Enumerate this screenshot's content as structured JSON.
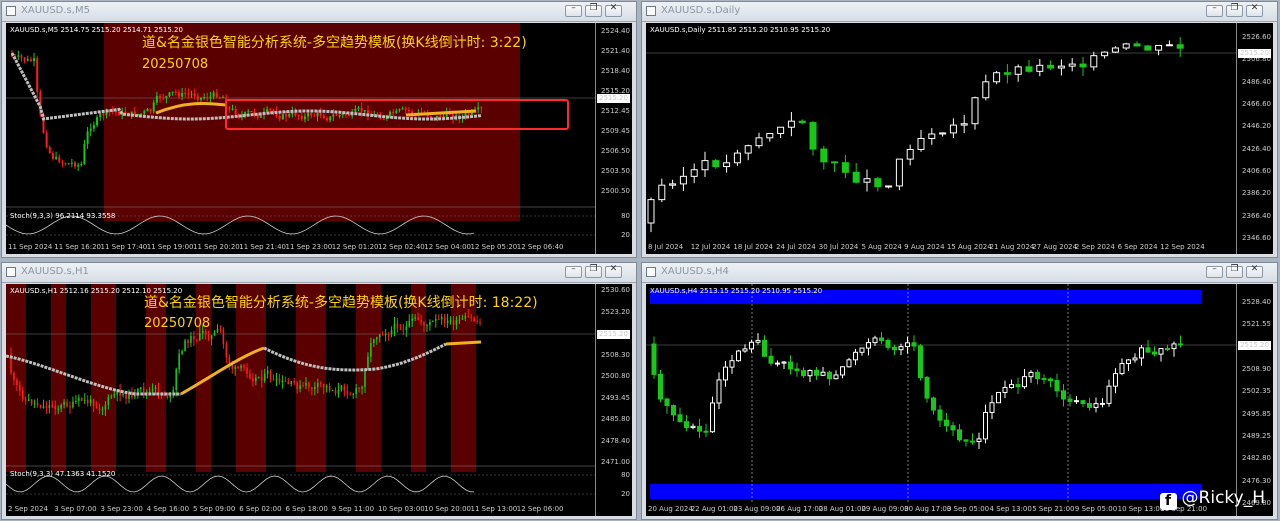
{
  "windows": [
    {
      "id": "m5",
      "title": "XAUUSD.s,M5",
      "header": "XAUUSD.s,M5  2514.75 2515.20 2514.71 2515.20",
      "overlay_title": "道&名金银色智能分析系统-多空趋势模板(换K线倒计时: 3:22)",
      "overlay_date": "20250708",
      "stoch": "Stoch(9,3,3) 96.2114 93.3558",
      "price_labels": [
        "2524.40",
        "2521.40",
        "2518.40",
        "2515.20",
        "2512.45",
        "2509.45",
        "2506.50",
        "2503.50",
        "2500.50"
      ],
      "stoch_labels": [
        "80",
        "20"
      ],
      "current_price": "2515.20",
      "time_labels": [
        "11 Sep 2024",
        "11 Sep 16:20",
        "11 Sep 17:40",
        "11 Sep 19:00",
        "11 Sep 20:20",
        "11 Sep 21:40",
        "11 Sep 23:00",
        "12 Sep 01:20",
        "12 Sep 02:40",
        "12 Sep 04:00",
        "12 Sep 05:20",
        "12 Sep 06:40"
      ],
      "colors": {
        "zone": "#5a0000",
        "box": "#ff2a2a",
        "ma": "#bfbfbf",
        "ma_hl": "#f0b020"
      }
    },
    {
      "id": "d1",
      "title": "XAUUSD.s,Daily",
      "header": "XAUUSD.s,Daily  2511.85 2515.20 2510.95 2515.20",
      "price_labels": [
        "2526.60",
        "2506.80",
        "2486.40",
        "2466.60",
        "2446.20",
        "2426.40",
        "2406.60",
        "2386.20",
        "2366.40",
        "2346.60"
      ],
      "current_price": "2515.20",
      "time_labels": [
        "8 Jul 2024",
        "12 Jul 2024",
        "18 Jul 2024",
        "24 Jul 2024",
        "30 Jul 2024",
        "5 Aug 2024",
        "9 Aug 2024",
        "15 Aug 2024",
        "21 Aug 2024",
        "27 Aug 2024",
        "2 Sep 2024",
        "6 Sep 2024",
        "12 Sep 2024"
      ]
    },
    {
      "id": "h1",
      "title": "XAUUSD.s,H1",
      "header": "XAUUSD.s,H1  2512.16 2515.20 2512.10 2515.20",
      "overlay_title": "道&名金银色智能分析系统-多空趋势模板(换K线倒计时: 18:22)",
      "overlay_date": "20250708",
      "stoch": "Stoch(9,3,3) 47.1363 41.1520",
      "price_labels": [
        "2530.60",
        "2523.20",
        "2515.20",
        "2508.30",
        "2500.80",
        "2493.45",
        "2485.80",
        "2478.40",
        "2471.00"
      ],
      "stoch_labels": [
        "80",
        "20"
      ],
      "current_price": "2515.20",
      "time_labels": [
        "2 Sep 2024",
        "3 Sep 07:00",
        "3 Sep 23:00",
        "4 Sep 16:00",
        "5 Sep 09:00",
        "6 Sep 02:00",
        "6 Sep 18:00",
        "9 Sep 11:00",
        "10 Sep 03:00",
        "10 Sep 20:00",
        "11 Sep 13:00",
        "12 Sep 06:00"
      ]
    },
    {
      "id": "h4",
      "title": "XAUUSD.s,H4",
      "header": "XAUUSD.s,H4  2513.15 2515.20 2510.95 2515.20",
      "price_labels": [
        "2528.40",
        "2521.55",
        "2515.20",
        "2508.90",
        "2502.35",
        "2495.85",
        "2489.25",
        "2482.80",
        "2476.30",
        "2469.80"
      ],
      "current_price": "2515.20",
      "time_labels": [
        "20 Aug 2024",
        "22 Aug 01:00",
        "23 Aug 09:00",
        "26 Aug 17:00",
        "28 Aug 01:00",
        "29 Aug 09:00",
        "30 Aug 17:00",
        "3 Sep 05:00",
        "4 Sep 13:00",
        "5 Sep 21:00",
        "9 Sep 05:00",
        "10 Sep 13:00",
        "11 Sep 21:00"
      ],
      "colors": {
        "band": "#0000ff"
      }
    }
  ],
  "watermark": {
    "icon": "f",
    "text": "@Ricky_H"
  }
}
